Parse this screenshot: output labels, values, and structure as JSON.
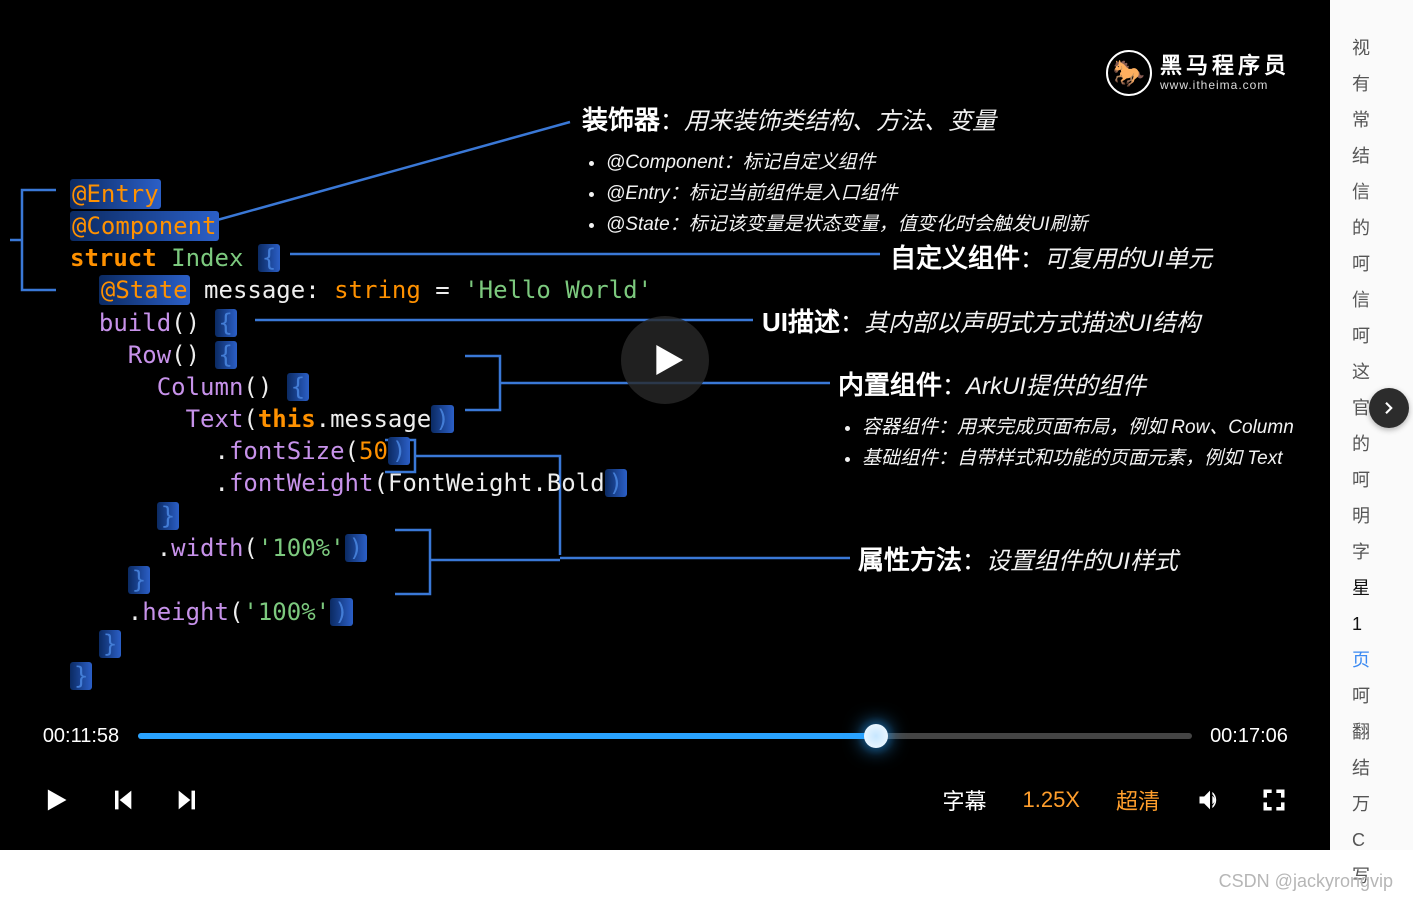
{
  "logo": {
    "title": "黑马程序员",
    "url": "www.itheima.com"
  },
  "code": {
    "l1a": "@Entry",
    "l2a": "@Component",
    "l3a": "struct",
    "l3b": " Index ",
    "l3c": "{",
    "l4a": "@State",
    "l4b": " message",
    "l4c": ": ",
    "l4d": "string",
    "l4e": " = ",
    "l4f": "'Hello World'",
    "l5a": "build",
    "l5b": "() ",
    "l5c": "{",
    "l6a": "Row",
    "l6b": "() ",
    "l6c": "{",
    "l7a": "Column",
    "l7b": "() ",
    "l7c": "{",
    "l8a": "Text",
    "l8b": "(",
    "l8c": "this",
    "l8d": ".message",
    "l8e": ")",
    "l9a": ".",
    "l9b": "fontSize",
    "l9c": "(",
    "l9d": "50",
    "l9e": ")",
    "l10a": ".",
    "l10b": "fontWeight",
    "l10c": "(",
    "l10d": "FontWeight.Bold",
    "l10e": ")",
    "l11a": "}",
    "l12a": ".",
    "l12b": "width",
    "l12c": "(",
    "l12d": "'100%'",
    "l12e": ")",
    "l13a": "}",
    "l14a": ".",
    "l14b": "height",
    "l14c": "(",
    "l14d": "'100%'",
    "l14e": ")",
    "l15a": "}",
    "l16a": "}"
  },
  "anno": {
    "a1": {
      "title": "装饰器",
      "sep": "：",
      "desc": "用来装饰类结构、方法、变量",
      "items": [
        "@Component：标记自定义组件",
        "@Entry：标记当前组件是入口组件",
        "@State：标记该变量是状态变量，值变化时会触发UI刷新"
      ]
    },
    "a2": {
      "title": "自定义组件",
      "sep": "：",
      "desc": "可复用的UI单元"
    },
    "a3": {
      "title": "UI描述",
      "sep": "：",
      "desc": "其内部以声明式方式描述UI结构"
    },
    "a4": {
      "title": "内置组件",
      "sep": "：",
      "desc": "ArkUI提供的组件",
      "items": [
        "容器组件：用来完成页面布局，例如 Row、Column",
        "基础组件：自带样式和功能的页面元素，例如 Text"
      ]
    },
    "a5": {
      "title": "属性方法",
      "sep": "：",
      "desc": "设置组件的UI样式"
    }
  },
  "player": {
    "current": "00:11:58",
    "total": "00:17:06",
    "progressPct": 70,
    "subtitle": "字幕",
    "speed": "1.25X",
    "quality": "超清"
  },
  "side": [
    "视",
    "有",
    "常",
    "结",
    "信",
    "的",
    "呵",
    "信",
    "呵",
    "这",
    "官",
    "的",
    "呵",
    "明",
    "字",
    "星",
    "1",
    "页",
    "呵",
    "翻",
    "结",
    "万",
    "C",
    "写"
  ],
  "watermark": "CSDN @jackyrongvip"
}
